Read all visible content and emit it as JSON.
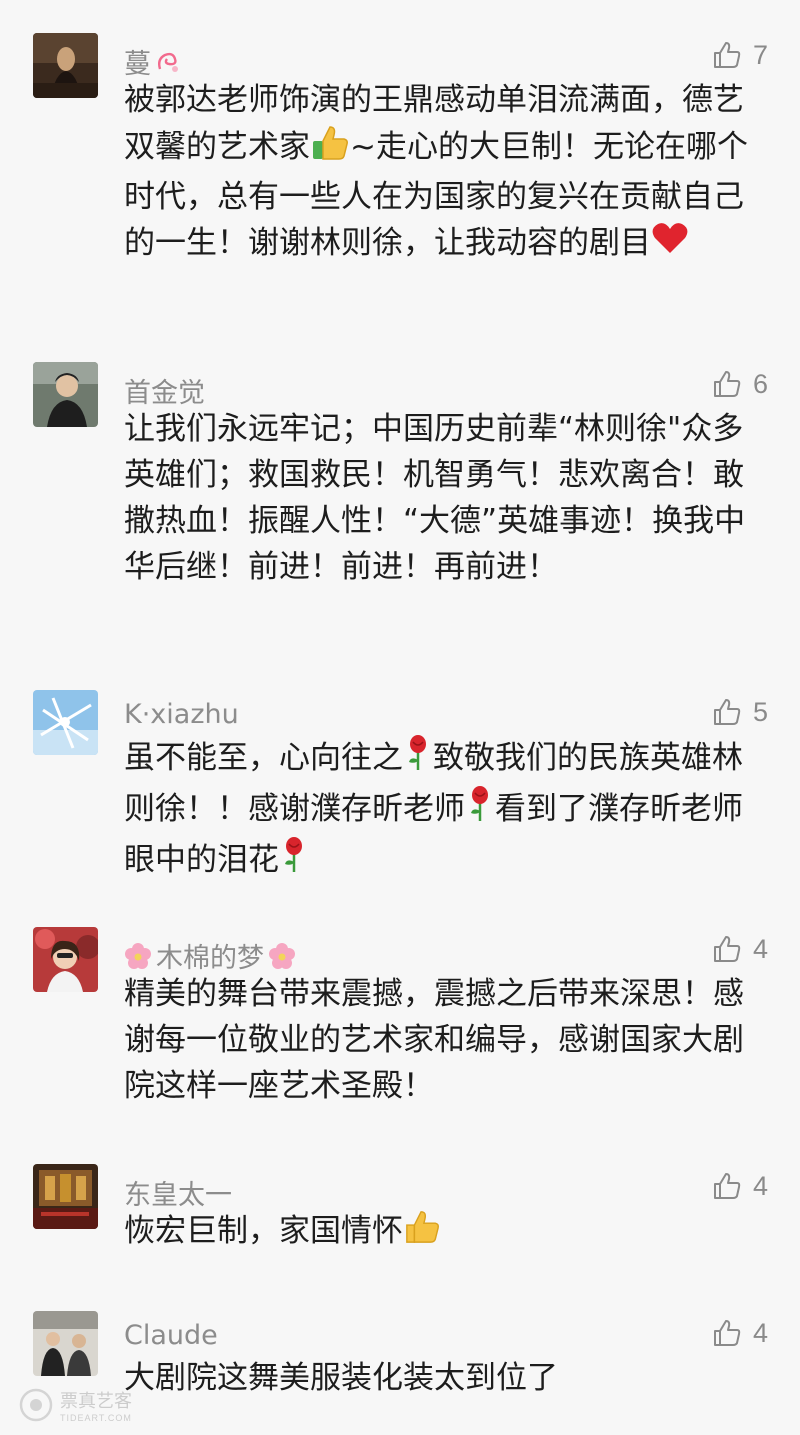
{
  "comments": [
    {
      "user": "蔓",
      "likes": "7",
      "text": "被郭达老师饰演的王鼎感动单泪流满面，德艺双馨的艺术家",
      "text_2": "~走心的大巨制！无论在哪个时代，总有一些人在为国家的复兴在贡献自己的一生！谢谢林则徐，让我动容的剧目",
      "emoji": [
        "thumbs-up-icon",
        "red-heart-icon"
      ]
    },
    {
      "user": "首金觉",
      "likes": "6",
      "text": "让我们永远牢记；中国历史前辈“林则徐\"众多英雄们；救国救民！机智勇气！悲欢离合！敢撒热血！振醒人性！“大德”英雄事迹！换我中华后继！前进！前进！再前进！"
    },
    {
      "user": "K·xiazhu",
      "likes": "5",
      "text": "虽不能至，心向往之",
      "text_2": "致敬我们的民族英雄林则徐！！感谢濮存昕老师",
      "text_3": "看到了濮存昕老师眼中的泪花",
      "emoji": [
        "rose-icon",
        "rose-icon",
        "rose-icon"
      ]
    },
    {
      "user": "木棉的梦",
      "likes": "4",
      "text": "精美的舞台带来震撼，震撼之后带来深思！感谢每一位敬业的艺术家和编导，感谢国家大剧院这样一座艺术圣殿！",
      "emoji": [
        "flower-icon",
        "flower-icon"
      ]
    },
    {
      "user": "东皇太一",
      "likes": "4",
      "text": "恢宏巨制，家国情怀",
      "emoji": [
        "thumbs-up-icon"
      ]
    },
    {
      "user": "Claude",
      "likes": "4",
      "text": "大剧院这舞美服装化装太到位了"
    }
  ],
  "watermark": {
    "title": "票真艺客",
    "subtitle": "TIDEART.COM"
  },
  "colors": {
    "background": "#f7f7f7",
    "username": "#8c8c8c",
    "body_text": "#1d1d1d",
    "like_icon": "#8a8a8a"
  }
}
